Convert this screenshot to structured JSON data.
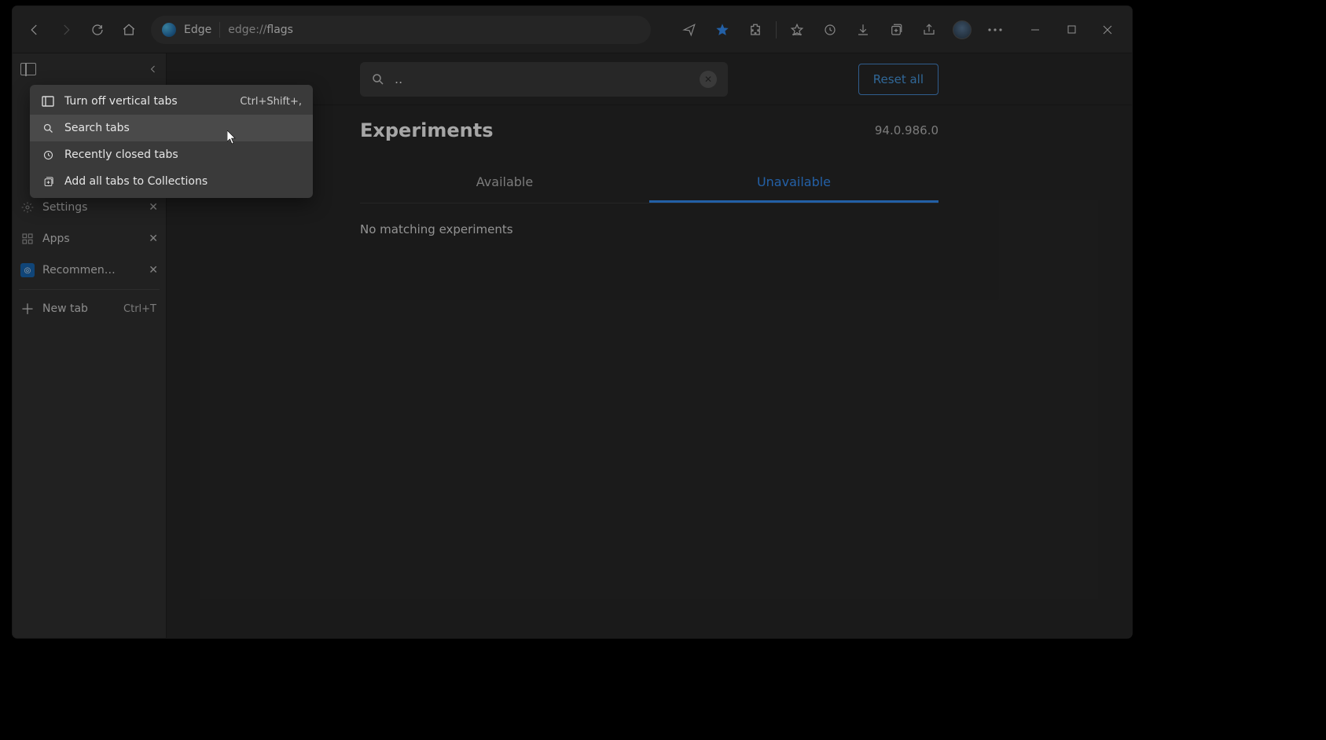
{
  "address_bar": {
    "brand": "Edge",
    "url_prefix": "edge://",
    "url_page": "flags"
  },
  "sidebar": {
    "tabs": [
      {
        "label": "Settings"
      },
      {
        "label": "Apps"
      },
      {
        "label": "Recommended D"
      }
    ],
    "new_tab_label": "New tab",
    "new_tab_shortcut": "Ctrl+T"
  },
  "menu": {
    "items": [
      {
        "label": "Turn off vertical tabs",
        "shortcut": "Ctrl+Shift+,"
      },
      {
        "label": "Search tabs"
      },
      {
        "label": "Recently closed tabs"
      },
      {
        "label": "Add all tabs to Collections"
      }
    ]
  },
  "flags_page": {
    "search_value": "..",
    "reset_label": "Reset all",
    "title": "Experiments",
    "version": "94.0.986.0",
    "tab_available": "Available",
    "tab_unavailable": "Unavailable",
    "empty_msg": "No matching experiments"
  }
}
